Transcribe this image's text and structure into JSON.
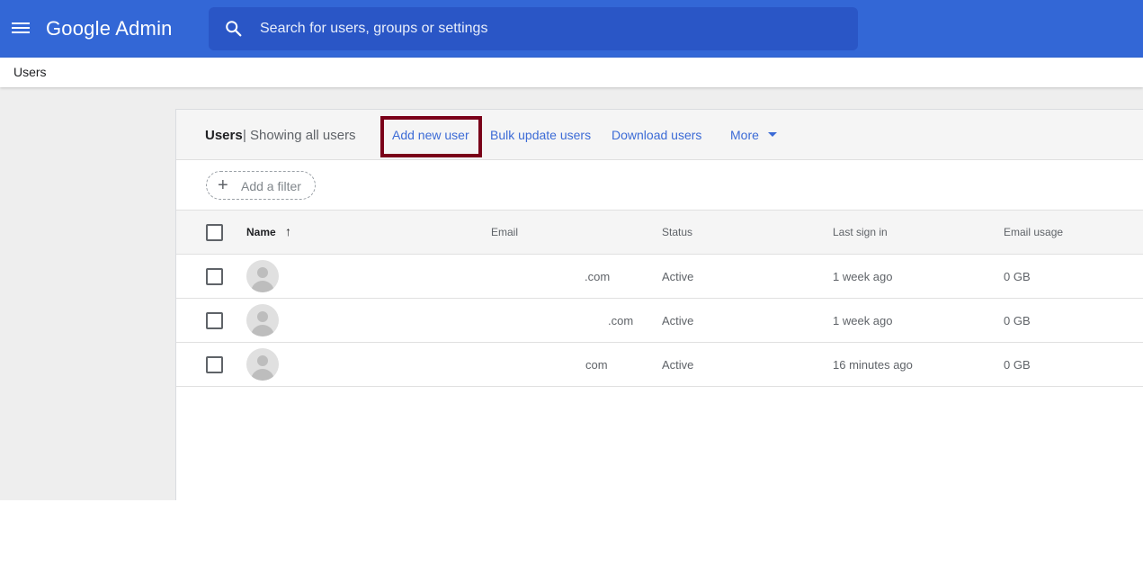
{
  "app": {
    "brand": "Google Admin"
  },
  "search": {
    "placeholder": "Search for users, groups or settings"
  },
  "breadcrumb": {
    "current": "Users"
  },
  "panel": {
    "title": "Users",
    "separator": "|",
    "subtitle": "Showing all users",
    "actions": {
      "add": "Add new user",
      "bulk": "Bulk update users",
      "download": "Download users",
      "more": "More"
    },
    "filter_label": "Add a filter"
  },
  "table": {
    "columns": {
      "name": "Name",
      "email": "Email",
      "status": "Status",
      "last_sign_in": "Last sign in",
      "email_usage": "Email usage"
    },
    "rows": [
      {
        "email": ".com",
        "status": "Active",
        "last_sign_in": "1 week ago",
        "email_usage": "0 GB"
      },
      {
        "email": ".com",
        "status": "Active",
        "last_sign_in": "1 week ago",
        "email_usage": "0 GB"
      },
      {
        "email": "com",
        "status": "Active",
        "last_sign_in": "16 minutes ago",
        "email_usage": "0 GB"
      }
    ]
  },
  "colors": {
    "header": "#3367d6",
    "search": "#2a56c6",
    "link": "#3c6bd6",
    "highlight": "#7a0019"
  },
  "icons": [
    "menu-icon",
    "search-icon",
    "add-icon",
    "sort-arrow-up-icon",
    "dropdown-caret-icon",
    "avatar-icon"
  ]
}
